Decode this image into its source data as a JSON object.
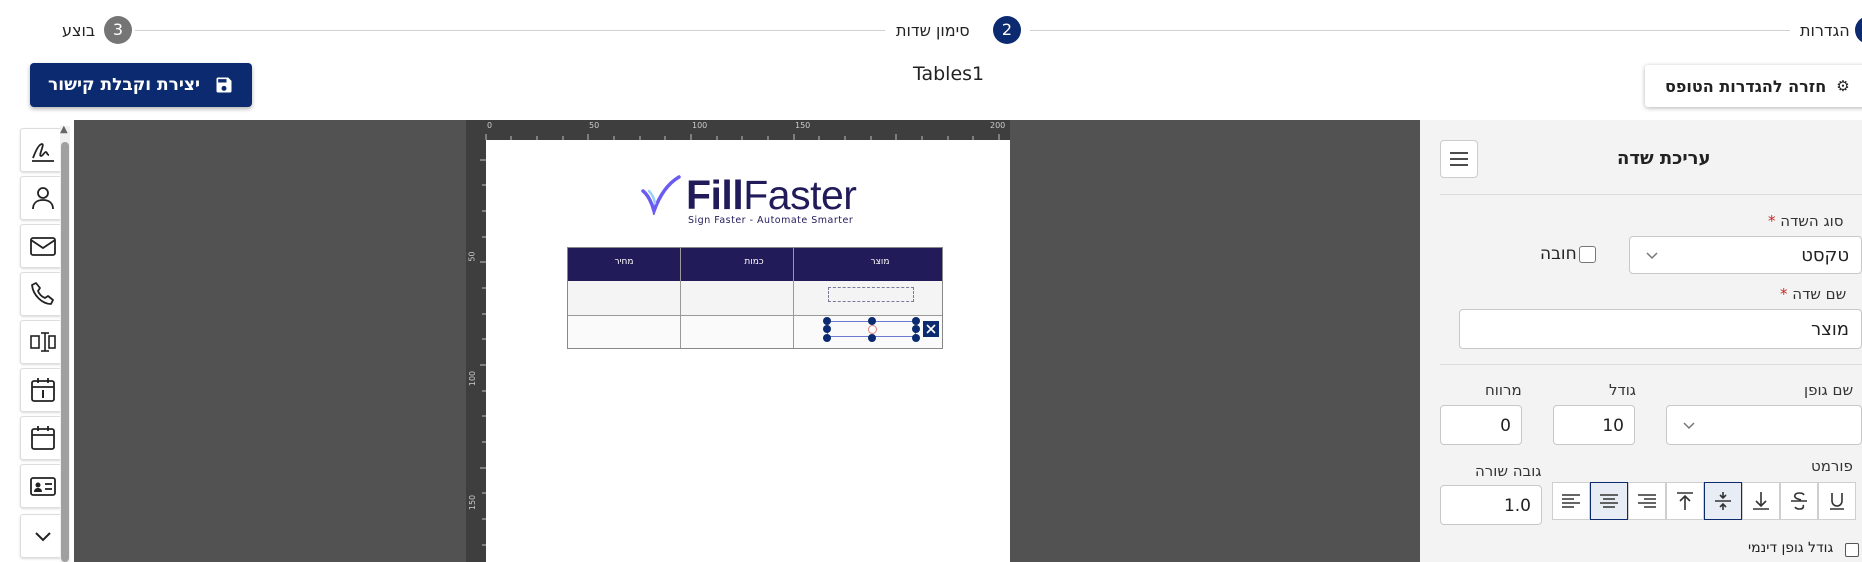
{
  "stepper": {
    "steps": [
      {
        "number": "1",
        "label": "הגדרות"
      },
      {
        "number": "2",
        "label": "סימון שדות"
      },
      {
        "number": "3",
        "label": "בוצע"
      }
    ]
  },
  "header": {
    "save_label": "יצירת וקבלת קישור",
    "form_title": "Tables1",
    "back_label": "חזרה להגדרות הטופס"
  },
  "toolbar": {
    "tools": [
      "signature-icon",
      "person-icon",
      "envelope-icon",
      "phone-icon",
      "text-field-icon",
      "calendar-day-icon",
      "calendar-icon",
      "id-card-icon",
      "chevron-down-icon"
    ]
  },
  "document": {
    "logo_text_fill": "Fill",
    "logo_text_faster": "Faster",
    "logo_tagline": "Sign Faster - Automate Smarter",
    "table_headers": [
      "מוצר",
      "כמות",
      "מחיר"
    ],
    "ruler_top_ticks": [
      "0",
      "50",
      "100",
      "150",
      "200"
    ],
    "ruler_left_ticks": [
      "50",
      "100",
      "150"
    ]
  },
  "panel": {
    "title": "עריכת שדה",
    "field_type_label": "סוג השדה",
    "field_type_value": "טקסט",
    "required_label": "חובה",
    "field_name_label": "שם שדה",
    "field_name_value": "מוצר",
    "font_name_label": "שם גופן",
    "size_label": "גודל",
    "size_value": "10",
    "spacing_label": "מרווח",
    "spacing_value": "0",
    "format_label": "פורמט",
    "line_height_label": "גובה שורה",
    "line_height_value": "1.0",
    "dynamic_font_label": "גודל גופן דינמי"
  },
  "colors": {
    "primary": "#0b2a6f",
    "table_header": "#221b5a",
    "step_done": "#757575"
  }
}
